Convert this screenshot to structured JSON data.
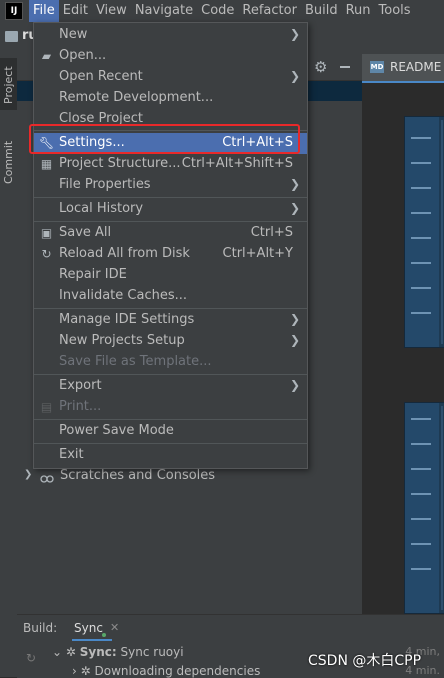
{
  "menubar": {
    "logo": "IJ",
    "items": [
      "File",
      "Edit",
      "View",
      "Navigate",
      "Code",
      "Refactor",
      "Build",
      "Run",
      "Tools"
    ]
  },
  "project": {
    "name": "ru"
  },
  "left_strip": {
    "project_tab": "Project",
    "commit_tab": "Commit"
  },
  "editor": {
    "tab_label": "README",
    "tab_icon_text": "MD"
  },
  "tree": {
    "scratches": "Scratches and Consoles"
  },
  "file_menu": {
    "items": [
      {
        "label": "New",
        "shortcut": "",
        "submenu": true,
        "icon": ""
      },
      {
        "label": "Open...",
        "shortcut": "",
        "submenu": false,
        "icon": "folder-icon"
      },
      {
        "label": "Open Recent",
        "shortcut": "",
        "submenu": true,
        "icon": ""
      },
      {
        "label": "Remote Development...",
        "shortcut": "",
        "submenu": false,
        "icon": ""
      },
      {
        "label": "Close Project",
        "shortcut": "",
        "submenu": false,
        "icon": ""
      },
      {
        "label": "Settings...",
        "shortcut": "Ctrl+Alt+S",
        "submenu": false,
        "icon": "wrench-icon"
      },
      {
        "label": "Project Structure...",
        "shortcut": "Ctrl+Alt+Shift+S",
        "submenu": false,
        "icon": "project-structure-icon"
      },
      {
        "label": "File Properties",
        "shortcut": "",
        "submenu": true,
        "icon": ""
      },
      {
        "label": "Local History",
        "shortcut": "",
        "submenu": true,
        "icon": ""
      },
      {
        "label": "Save All",
        "shortcut": "Ctrl+S",
        "submenu": false,
        "icon": "save-icon"
      },
      {
        "label": "Reload All from Disk",
        "shortcut": "Ctrl+Alt+Y",
        "submenu": false,
        "icon": "reload-icon"
      },
      {
        "label": "Repair IDE",
        "shortcut": "",
        "submenu": false,
        "icon": ""
      },
      {
        "label": "Invalidate Caches...",
        "shortcut": "",
        "submenu": false,
        "icon": ""
      },
      {
        "label": "Manage IDE Settings",
        "shortcut": "",
        "submenu": true,
        "icon": ""
      },
      {
        "label": "New Projects Setup",
        "shortcut": "",
        "submenu": true,
        "icon": ""
      },
      {
        "label": "Save File as Template...",
        "shortcut": "",
        "submenu": false,
        "icon": ""
      },
      {
        "label": "Export",
        "shortcut": "",
        "submenu": true,
        "icon": ""
      },
      {
        "label": "Print...",
        "shortcut": "",
        "submenu": false,
        "icon": "print-icon"
      },
      {
        "label": "Power Save Mode",
        "shortcut": "",
        "submenu": false,
        "icon": ""
      },
      {
        "label": "Exit",
        "shortcut": "",
        "submenu": false,
        "icon": ""
      }
    ],
    "highlighted": "Settings...",
    "disabled": [
      "Save File as Template...",
      "Print..."
    ]
  },
  "build": {
    "label": "Build:",
    "tab": "Sync",
    "row1_bold": "Sync:",
    "row1_text": "Sync ruoyi",
    "row2_text": "Downloading dependencies",
    "time1": "4 min,",
    "time2": "4 min."
  },
  "watermark": "CSDN @木白CPP",
  "colors": {
    "accent": "#4b6eaf",
    "highlight_box": "#e8292a",
    "background": "#2b2b2b",
    "panel": "#3c3f41"
  }
}
